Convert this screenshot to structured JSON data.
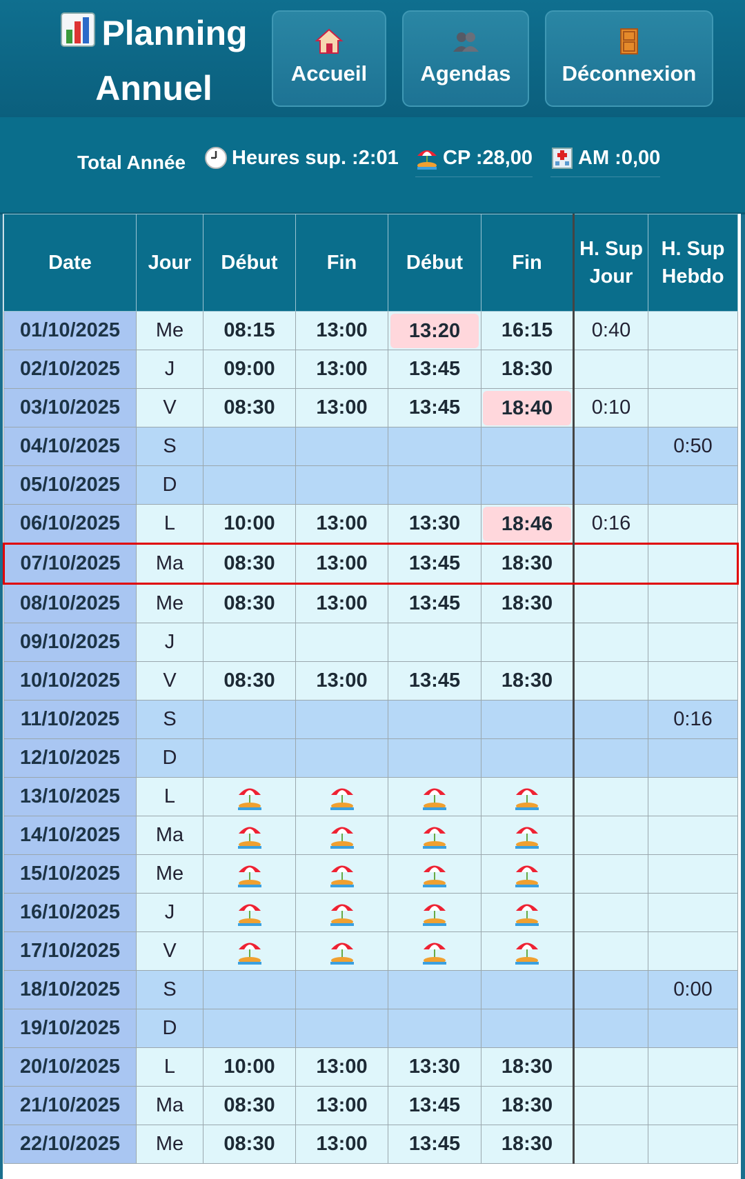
{
  "header": {
    "title": "Planning Annuel",
    "buttons": [
      {
        "label": "Accueil",
        "icon": "house-icon"
      },
      {
        "label": "Agendas",
        "icon": "people-icon"
      },
      {
        "label": "Déconnexion",
        "icon": "door-icon"
      }
    ]
  },
  "totals": {
    "title": "Total Année",
    "heures_sup": "Heures sup. :2:01",
    "cp": "CP :28,00",
    "am": "AM :0,00"
  },
  "table": {
    "headers": [
      "Date",
      "Jour",
      "Début",
      "Fin",
      "Début",
      "Fin",
      "H. Sup Jour",
      "H. Sup Hebdo"
    ],
    "rows": [
      {
        "date": "01/10/2025",
        "day": "Me",
        "d1": "08:15",
        "f1": "13:00",
        "d2": "13:20",
        "f2": "16:15",
        "hj": "0:40",
        "hh": "",
        "late": [
          2
        ]
      },
      {
        "date": "02/10/2025",
        "day": "J",
        "d1": "09:00",
        "f1": "13:00",
        "d2": "13:45",
        "f2": "18:30",
        "hj": "",
        "hh": ""
      },
      {
        "date": "03/10/2025",
        "day": "V",
        "d1": "08:30",
        "f1": "13:00",
        "d2": "13:45",
        "f2": "18:40",
        "hj": "0:10",
        "hh": "",
        "late": [
          3
        ]
      },
      {
        "date": "04/10/2025",
        "day": "S",
        "d1": "",
        "f1": "",
        "d2": "",
        "f2": "",
        "hj": "",
        "hh": "0:50",
        "we": true
      },
      {
        "date": "05/10/2025",
        "day": "D",
        "d1": "",
        "f1": "",
        "d2": "",
        "f2": "",
        "hj": "",
        "hh": "",
        "we": true
      },
      {
        "date": "06/10/2025",
        "day": "L",
        "d1": "10:00",
        "f1": "13:00",
        "d2": "13:30",
        "f2": "18:46",
        "hj": "0:16",
        "hh": "",
        "late": [
          3
        ]
      },
      {
        "date": "07/10/2025",
        "day": "Ma",
        "d1": "08:30",
        "f1": "13:00",
        "d2": "13:45",
        "f2": "18:30",
        "hj": "",
        "hh": "",
        "sel": true
      },
      {
        "date": "08/10/2025",
        "day": "Me",
        "d1": "08:30",
        "f1": "13:00",
        "d2": "13:45",
        "f2": "18:30",
        "hj": "",
        "hh": ""
      },
      {
        "date": "09/10/2025",
        "day": "J",
        "d1": "",
        "f1": "",
        "d2": "",
        "f2": "",
        "hj": "",
        "hh": ""
      },
      {
        "date": "10/10/2025",
        "day": "V",
        "d1": "08:30",
        "f1": "13:00",
        "d2": "13:45",
        "f2": "18:30",
        "hj": "",
        "hh": ""
      },
      {
        "date": "11/10/2025",
        "day": "S",
        "d1": "",
        "f1": "",
        "d2": "",
        "f2": "",
        "hj": "",
        "hh": "0:16",
        "we": true
      },
      {
        "date": "12/10/2025",
        "day": "D",
        "d1": "",
        "f1": "",
        "d2": "",
        "f2": "",
        "hj": "",
        "hh": "",
        "we": true
      },
      {
        "date": "13/10/2025",
        "day": "L",
        "cp": true,
        "hj": "",
        "hh": ""
      },
      {
        "date": "14/10/2025",
        "day": "Ma",
        "cp": true,
        "hj": "",
        "hh": ""
      },
      {
        "date": "15/10/2025",
        "day": "Me",
        "cp": true,
        "hj": "",
        "hh": ""
      },
      {
        "date": "16/10/2025",
        "day": "J",
        "cp": true,
        "hj": "",
        "hh": ""
      },
      {
        "date": "17/10/2025",
        "day": "V",
        "cp": true,
        "hj": "",
        "hh": ""
      },
      {
        "date": "18/10/2025",
        "day": "S",
        "d1": "",
        "f1": "",
        "d2": "",
        "f2": "",
        "hj": "",
        "hh": "0:00",
        "we": true
      },
      {
        "date": "19/10/2025",
        "day": "D",
        "d1": "",
        "f1": "",
        "d2": "",
        "f2": "",
        "hj": "",
        "hh": "",
        "we": true
      },
      {
        "date": "20/10/2025",
        "day": "L",
        "d1": "10:00",
        "f1": "13:00",
        "d2": "13:30",
        "f2": "18:30",
        "hj": "",
        "hh": ""
      },
      {
        "date": "21/10/2025",
        "day": "Ma",
        "d1": "08:30",
        "f1": "13:00",
        "d2": "13:45",
        "f2": "18:30",
        "hj": "",
        "hh": ""
      },
      {
        "date": "22/10/2025",
        "day": "Me",
        "d1": "08:30",
        "f1": "13:00",
        "d2": "13:45",
        "f2": "18:30",
        "hj": "",
        "hh": ""
      }
    ]
  }
}
